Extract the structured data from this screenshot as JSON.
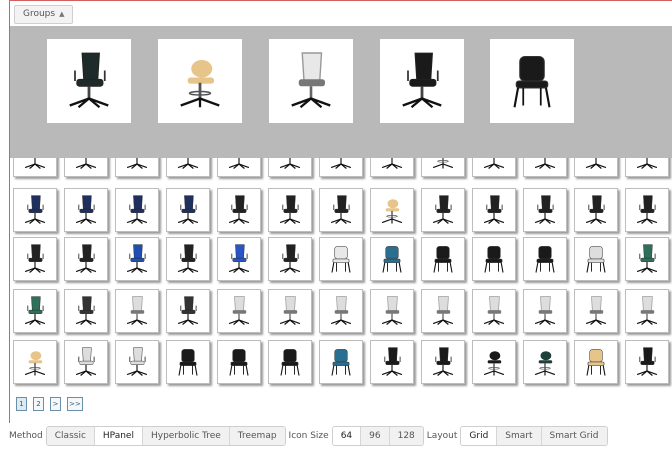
{
  "groups_button": {
    "label": "Groups",
    "icon": "triangle-up-icon"
  },
  "hpanel_items": [
    {
      "color": "#1e2b2a",
      "style": "office"
    },
    {
      "color": "#e6c48a",
      "style": "stool"
    },
    {
      "color": "#e8e8e8",
      "style": "mesh"
    },
    {
      "color": "#1a1a1a",
      "style": "office"
    },
    {
      "color": "#1a1a1a",
      "style": "visitor"
    }
  ],
  "grid_rows": [
    [
      {
        "color": "#d9923a",
        "style": "office"
      },
      {
        "color": "#d9923a",
        "style": "office"
      },
      {
        "color": "#333333",
        "style": "office"
      },
      {
        "color": "#333333",
        "style": "office"
      },
      {
        "color": "#333333",
        "style": "office"
      },
      {
        "color": "#333333",
        "style": "office"
      },
      {
        "color": "#333333",
        "style": "office"
      },
      {
        "color": "#333333",
        "style": "office"
      },
      {
        "color": "#333333",
        "style": "stool"
      },
      {
        "color": "#333333",
        "style": "office"
      },
      {
        "color": "#333333",
        "style": "office"
      },
      {
        "color": "#333333",
        "style": "office"
      },
      {
        "color": "#333333",
        "style": "office"
      }
    ],
    [
      {
        "color": "#1f2f5e",
        "style": "office"
      },
      {
        "color": "#1f2f5e",
        "style": "office"
      },
      {
        "color": "#1f2f5e",
        "style": "office"
      },
      {
        "color": "#1f2f5e",
        "style": "office"
      },
      {
        "color": "#222222",
        "style": "office"
      },
      {
        "color": "#222222",
        "style": "office"
      },
      {
        "color": "#222222",
        "style": "office"
      },
      {
        "color": "#e6c48a",
        "style": "stool"
      },
      {
        "color": "#222222",
        "style": "office"
      },
      {
        "color": "#222222",
        "style": "office"
      },
      {
        "color": "#222222",
        "style": "office"
      },
      {
        "color": "#222222",
        "style": "office"
      },
      {
        "color": "#222222",
        "style": "office"
      }
    ],
    [
      {
        "color": "#222222",
        "style": "office"
      },
      {
        "color": "#222222",
        "style": "office"
      },
      {
        "color": "#1f4fb0",
        "style": "office"
      },
      {
        "color": "#222222",
        "style": "office"
      },
      {
        "color": "#2a55c9",
        "style": "office"
      },
      {
        "color": "#222222",
        "style": "office"
      },
      {
        "color": "#e8e8e8",
        "style": "visitor"
      },
      {
        "color": "#2a6f8f",
        "style": "visitor"
      },
      {
        "color": "#1a1a1a",
        "style": "visitor"
      },
      {
        "color": "#1a1a1a",
        "style": "visitor"
      },
      {
        "color": "#1a1a1a",
        "style": "visitor"
      },
      {
        "color": "#dddddd",
        "style": "visitor"
      },
      {
        "color": "#2f6f5c",
        "style": "office"
      }
    ],
    [
      {
        "color": "#2f6f5c",
        "style": "office"
      },
      {
        "color": "#333333",
        "style": "office"
      },
      {
        "color": "#dddddd",
        "style": "mesh"
      },
      {
        "color": "#333333",
        "style": "office"
      },
      {
        "color": "#dddddd",
        "style": "mesh"
      },
      {
        "color": "#dddddd",
        "style": "mesh"
      },
      {
        "color": "#dddddd",
        "style": "mesh"
      },
      {
        "color": "#dddddd",
        "style": "mesh"
      },
      {
        "color": "#dddddd",
        "style": "mesh"
      },
      {
        "color": "#dddddd",
        "style": "mesh"
      },
      {
        "color": "#dddddd",
        "style": "mesh"
      },
      {
        "color": "#dddddd",
        "style": "mesh"
      },
      {
        "color": "#dddddd",
        "style": "mesh"
      }
    ],
    [
      {
        "color": "#e6c48a",
        "style": "stool"
      },
      {
        "color": "#dddddd",
        "style": "office"
      },
      {
        "color": "#dddddd",
        "style": "office"
      },
      {
        "color": "#1a1a1a",
        "style": "visitor"
      },
      {
        "color": "#1a1a1a",
        "style": "visitor"
      },
      {
        "color": "#1a1a1a",
        "style": "visitor"
      },
      {
        "color": "#2a6f8f",
        "style": "visitor"
      },
      {
        "color": "#1a1a1a",
        "style": "office"
      },
      {
        "color": "#1a1a1a",
        "style": "office"
      },
      {
        "color": "#1a1a1a",
        "style": "stool"
      },
      {
        "color": "#1f3f3a",
        "style": "stool"
      },
      {
        "color": "#e6c48a",
        "style": "visitor"
      },
      {
        "color": "#1a1a1a",
        "style": "office"
      }
    ]
  ],
  "pagination": [
    "1",
    "2",
    ">",
    ">>"
  ],
  "toolbar": {
    "method_label": "Method",
    "method_options": [
      "Classic",
      "HPanel",
      "Hyperbolic Tree",
      "Treemap"
    ],
    "method_selected": "HPanel",
    "icon_size_label": "Icon Size",
    "icon_size_options": [
      "64",
      "96",
      "128"
    ],
    "icon_size_selected": "64",
    "layout_label": "Layout",
    "layout_options": [
      "Grid",
      "Smart",
      "Smart Grid"
    ],
    "layout_selected": "Grid"
  }
}
